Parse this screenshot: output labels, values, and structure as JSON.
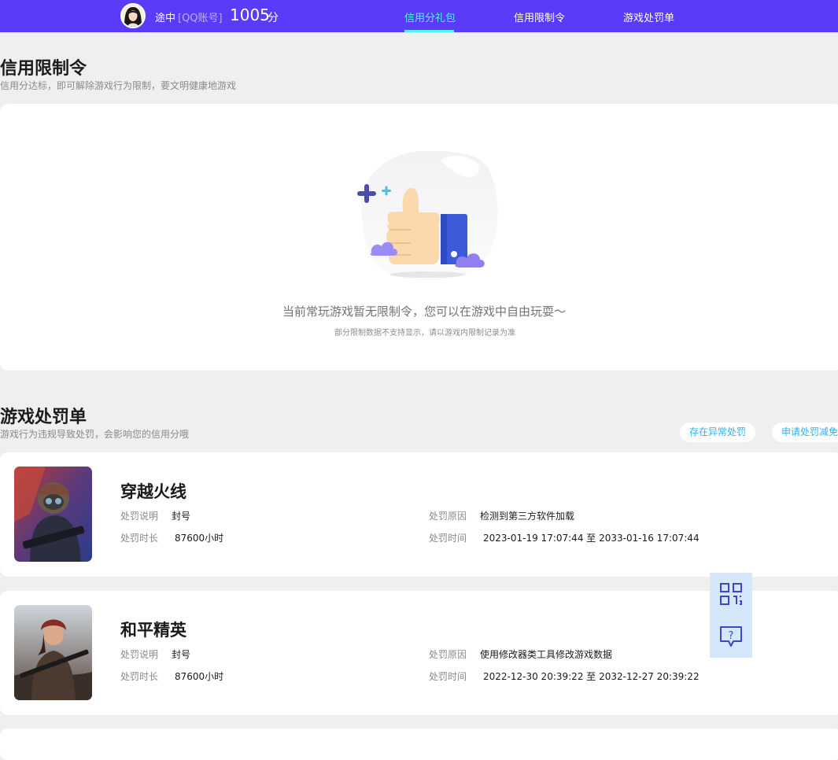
{
  "header": {
    "user_name": "途中",
    "account_type": "[QQ账号]",
    "score": "1005",
    "score_unit": "分",
    "tabs": [
      {
        "label": "信用分礼包",
        "active": true
      },
      {
        "label": "信用限制令",
        "active": false
      },
      {
        "label": "游戏处罚单",
        "active": false
      }
    ],
    "colors": {
      "bar": "#5b3bfa",
      "active_tab": "#4ff2ff"
    }
  },
  "restrictions": {
    "title": "信用限制令",
    "subtitle": "信用分达标，即可解除游戏行为限制，要文明健康地游戏",
    "empty_message": "当前常玩游戏暂无限制令，您可以在游戏中自由玩耍～",
    "empty_note": "部分限制数据不支持显示，请以游戏内限制记录为准",
    "illustration_icon": "thumbs-up-illustration"
  },
  "penalties": {
    "title": "游戏处罚单",
    "subtitle": "游戏行为违规导致处罚，会影响您的信用分哦",
    "actions": [
      "存在异常处罚",
      "申请处罚减免"
    ],
    "labels": {
      "description": "处罚说明",
      "duration": "处罚时长",
      "reason": "处罚原因",
      "time": "处罚时间"
    },
    "items": [
      {
        "game": "穿越火线",
        "description": "封号",
        "duration": "87600小时",
        "reason": "检测到第三方软件加载",
        "time_start": "2023-01-19 17:07:44",
        "time_sep": "至",
        "time_end": "2033-01-16 17:07:44"
      },
      {
        "game": "和平精英",
        "description": "封号",
        "duration": "87600小时",
        "reason": "使用修改器类工具修改游戏数据",
        "time_start": "2022-12-30 20:39:22",
        "time_sep": "至",
        "time_end": "2032-12-27 20:39:22"
      }
    ]
  },
  "floating": {
    "icons": [
      "qr-code-icon",
      "feedback-icon"
    ]
  }
}
